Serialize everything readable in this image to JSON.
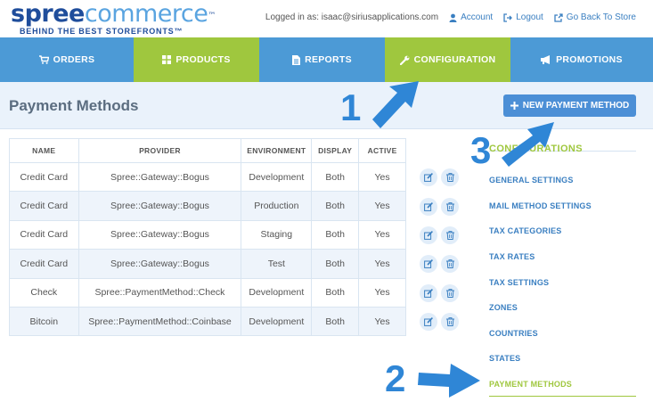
{
  "logo": {
    "word1": "spree",
    "word2": "commerce",
    "tm": "™",
    "tagline": "BEHIND THE BEST STOREFRONTS™"
  },
  "user": {
    "logged_in_as": "Logged in as: isaac@siriusapplications.com",
    "account": "Account",
    "logout": "Logout",
    "back_to_store": "Go Back To Store"
  },
  "nav": [
    {
      "label": "ORDERS",
      "icon": "cart-icon"
    },
    {
      "label": "PRODUCTS",
      "icon": "grid-icon"
    },
    {
      "label": "REPORTS",
      "icon": "file-icon"
    },
    {
      "label": "CONFIGURATION",
      "icon": "wrench-icon"
    },
    {
      "label": "PROMOTIONS",
      "icon": "bullhorn-icon"
    }
  ],
  "page": {
    "title": "Payment Methods",
    "new_button": "NEW PAYMENT METHOD"
  },
  "table": {
    "headers": [
      "NAME",
      "PROVIDER",
      "ENVIRONMENT",
      "DISPLAY",
      "ACTIVE"
    ],
    "rows": [
      [
        "Credit Card",
        "Spree::Gateway::Bogus",
        "Development",
        "Both",
        "Yes"
      ],
      [
        "Credit Card",
        "Spree::Gateway::Bogus",
        "Production",
        "Both",
        "Yes"
      ],
      [
        "Credit Card",
        "Spree::Gateway::Bogus",
        "Staging",
        "Both",
        "Yes"
      ],
      [
        "Credit Card",
        "Spree::Gateway::Bogus",
        "Test",
        "Both",
        "Yes"
      ],
      [
        "Check",
        "Spree::PaymentMethod::Check",
        "Development",
        "Both",
        "Yes"
      ],
      [
        "Bitcoin",
        "Spree::PaymentMethod::Coinbase",
        "Development",
        "Both",
        "Yes"
      ]
    ]
  },
  "sidebar": {
    "title": "CONFIGURATIONS",
    "items": [
      "GENERAL SETTINGS",
      "MAIL METHOD SETTINGS",
      "TAX CATEGORIES",
      "TAX RATES",
      "TAX SETTINGS",
      "ZONES",
      "COUNTRIES",
      "STATES",
      "PAYMENT METHODS"
    ]
  },
  "annotations": {
    "one": "1",
    "two": "2",
    "three": "3"
  },
  "colors": {
    "nav_blue": "#4c9ad6",
    "nav_green": "#9fc73e",
    "link_blue": "#3a7fc1",
    "annotation_blue": "#2f86d6"
  }
}
